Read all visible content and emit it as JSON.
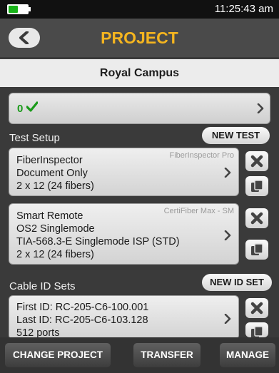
{
  "status": {
    "time": "11:25:43 am",
    "battery_level": 0.5,
    "battery_color": "#18b318"
  },
  "header": {
    "title": "PROJECT",
    "back_icon": "chevron-left-icon",
    "title_color": "#f5b51f"
  },
  "project": {
    "name": "Royal Campus"
  },
  "results": {
    "pass_count": "0",
    "pass_icon": "check-icon",
    "pass_color": "#1a9a1a"
  },
  "test_setup": {
    "label": "Test Setup",
    "new_button": "NEW TEST",
    "cards": [
      {
        "tag": "FiberInspector Pro",
        "lines": [
          "FiberInspector",
          "Document Only",
          "2 x 12 (24 fibers)"
        ]
      },
      {
        "tag": "CertiFiber Max - SM",
        "lines": [
          "Smart Remote",
          "OS2 Singlemode",
          "TIA-568.3-E Singlemode ISP (STD)",
          "2 x 12 (24 fibers)"
        ]
      }
    ]
  },
  "cable_id_sets": {
    "label": "Cable ID Sets",
    "new_button": "NEW ID SET",
    "cards": [
      {
        "lines": [
          "First ID: RC-205-C6-100.001",
          "Last ID: RC-205-C6-103.128",
          "512 ports"
        ]
      }
    ]
  },
  "toolbar": {
    "change_project": "CHANGE PROJECT",
    "transfer": "TRANSFER",
    "manage": "MANAGE"
  }
}
